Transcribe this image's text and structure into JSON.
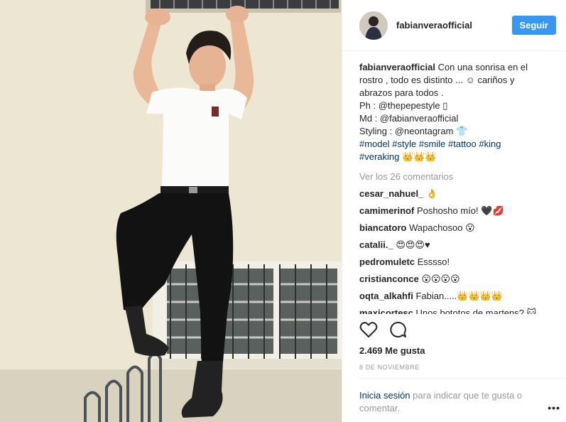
{
  "post": {
    "username": "fabianveraofficial",
    "follow_label": "Seguir",
    "caption": {
      "lines": [
        "Con una sonrisa en el",
        "rostro , todo es distinto ... ☺ cariños y",
        "abrazos para todos .",
        "Ph : @thepepestyle ▯",
        "Md : @fabianveraofficial",
        "Styling : @neontagram 👕",
        "#model #style #smile #tattoo #king",
        "#veraking 👑👑👑"
      ]
    },
    "view_comments": "Ver los 26 comentarios",
    "comments": [
      {
        "user": "cesar_nahuel_",
        "text": "👌"
      },
      {
        "user": "camimerinof",
        "text": "Poshosho mío! 🖤💋"
      },
      {
        "user": "biancatoro",
        "text": "Wapachosoo 😮"
      },
      {
        "user": "catalii._",
        "text": "😍😍😍♥"
      },
      {
        "user": "pedromuletc",
        "text": "Esssso!"
      },
      {
        "user": "cristianconce",
        "text": "😮😮😮😮"
      },
      {
        "user": "oqta_alkahfi",
        "text": "Fabian.....👑👑👑👑"
      },
      {
        "user": "maxicortesc",
        "text": "Unos bototos de martens? 🐱"
      }
    ],
    "likes": "2.469 Me gusta",
    "date": "8 DE NOVIEMBRE",
    "login_link": "Inicia sesión",
    "login_text": " para indicar que te gusta o comentar.",
    "more_options": "•••",
    "icons": {
      "like": "heart-icon",
      "comment": "comment-icon",
      "more": "more-options-icon"
    },
    "colors": {
      "accent": "#3897f0",
      "link": "#003569",
      "muted": "#999999"
    }
  }
}
